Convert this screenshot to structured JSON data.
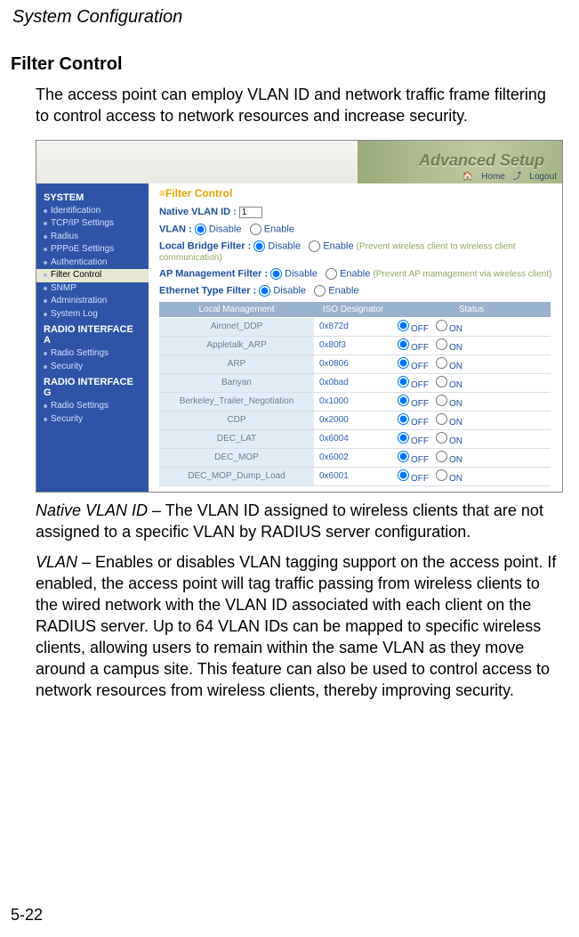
{
  "page": {
    "chapter_title": "System Configuration",
    "section_title": "Filter Control",
    "intro": "The access point can employ VLAN ID and network traffic frame filtering to control access to network resources and increase security.",
    "page_number": "5-22"
  },
  "screenshot": {
    "adv_setup": "Advanced Setup",
    "links": {
      "home": "Home",
      "logout": "Logout"
    },
    "sidebar": {
      "group_system": "SYSTEM",
      "items_system": [
        "Identification",
        "TCP/IP Settings",
        "Radius",
        "PPPoE Settings",
        "Authentication",
        "Filter Control",
        "SNMP",
        "Administration",
        "System Log"
      ],
      "group_radio_a": "RADIO INTERFACE A",
      "items_radio_a": [
        "Radio Settings",
        "Security"
      ],
      "group_radio_g": "RADIO INTERFACE G",
      "items_radio_g": [
        "Radio Settings",
        "Security"
      ]
    },
    "content": {
      "title": "Filter Control",
      "native_vlan_label": "Native VLAN ID  :",
      "native_vlan_value": "1",
      "vlan_label": "VLAN  :",
      "local_bridge_label": "Local Bridge Filter  :",
      "local_bridge_hint": "(Prevent wireless client to wireless client communication)",
      "ap_mgmt_label": "AP Management Filter  :",
      "ap_mgmt_hint": "(Prevent AP mamagement via wireless client)",
      "eth_type_label": "Ethernet Type Filter  :",
      "opt_disable": "Disable",
      "opt_enable": "Enable",
      "table_headers": [
        "Local Management",
        "ISO Designator",
        "Status"
      ],
      "status_off": "OFF",
      "status_on": "ON",
      "rows": [
        {
          "name": "Aironet_DDP",
          "iso": "0x872d"
        },
        {
          "name": "Appletalk_ARP",
          "iso": "0x80f3"
        },
        {
          "name": "ARP",
          "iso": "0x0806"
        },
        {
          "name": "Banyan",
          "iso": "0x0bad"
        },
        {
          "name": "Berkeley_Trailer_Negotiation",
          "iso": "0x1000"
        },
        {
          "name": "CDP",
          "iso": "0x2000"
        },
        {
          "name": "DEC_LAT",
          "iso": "0x6004"
        },
        {
          "name": "DEC_MOP",
          "iso": "0x6002"
        },
        {
          "name": "DEC_MOP_Dump_Load",
          "iso": "0x6001"
        }
      ]
    }
  },
  "definitions": {
    "native_vlan_term": "Native VLAN ID",
    "native_vlan_text": " – The VLAN ID assigned to wireless clients that are not assigned to a specific VLAN by RADIUS server configuration.",
    "vlan_term": "VLAN",
    "vlan_text": " – Enables or disables VLAN tagging support on the access point. If enabled, the access point will tag traffic passing from wireless clients to the wired network with the VLAN ID associated with each client on the RADIUS server. Up to 64 VLAN IDs can be mapped to specific wireless clients, allowing users to remain within the same VLAN as they move around a campus site. This feature can also be used to control access to network resources from wireless clients, thereby improving security."
  }
}
